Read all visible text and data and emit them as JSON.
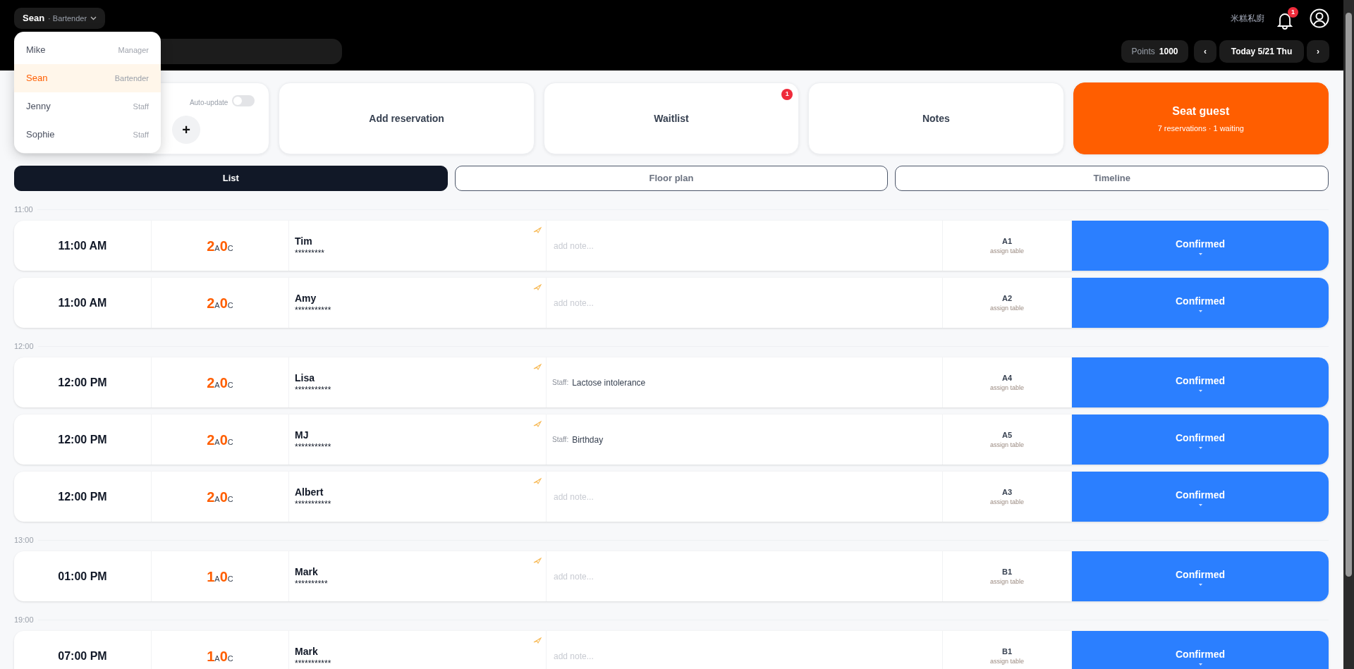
{
  "header": {
    "user": {
      "name": "Sean",
      "role": "· Bartender"
    },
    "restaurant": "米糕私廚",
    "notifications": "1",
    "points": {
      "label": "Points",
      "value": "1000"
    },
    "date": {
      "prev": "‹",
      "label": "Today 5/21 Thu",
      "next": "›"
    }
  },
  "staff_menu": [
    {
      "name": "Mike",
      "role": "Manager",
      "selected": false
    },
    {
      "name": "Sean",
      "role": "Bartender",
      "selected": true
    },
    {
      "name": "Jenny",
      "role": "Staff",
      "selected": false
    },
    {
      "name": "Sophie",
      "role": "Staff",
      "selected": false
    }
  ],
  "auto_update": {
    "label": "Auto-update",
    "on": false
  },
  "add_button": "+",
  "actions": [
    {
      "kind": "plain",
      "label": "Add reservation"
    },
    {
      "kind": "plain",
      "label": "Waitlist",
      "badge": "1"
    },
    {
      "kind": "plain",
      "label": "Notes"
    },
    {
      "kind": "primary",
      "label": "Seat guest",
      "sub": "7 reservations · 1 waiting"
    }
  ],
  "views": [
    {
      "label": "List",
      "selected": true
    },
    {
      "label": "Floor plan",
      "selected": false
    },
    {
      "label": "Timeline",
      "selected": false
    }
  ],
  "groups": [
    {
      "hour": "11:00",
      "rows": [
        {
          "time": "11:00 AM",
          "adults": "2",
          "adult_mark": "A",
          "children": "0",
          "child_mark": "C",
          "name": "Tim",
          "phone": "*********",
          "note_placeholder": "add note...",
          "table": "A1",
          "table_hint": "assign table",
          "status": "Confirmed"
        },
        {
          "time": "11:00 AM",
          "adults": "2",
          "adult_mark": "A",
          "children": "0",
          "child_mark": "C",
          "name": "Amy",
          "phone": "***********",
          "note_placeholder": "add note...",
          "table": "A2",
          "table_hint": "assign table",
          "status": "Confirmed"
        }
      ]
    },
    {
      "hour": "12:00",
      "rows": [
        {
          "time": "12:00 PM",
          "adults": "2",
          "adult_mark": "A",
          "children": "0",
          "child_mark": "C",
          "name": "Lisa",
          "phone": "***********",
          "note": {
            "label": "Staff:",
            "text": "Lactose intolerance"
          },
          "table": "A4",
          "table_hint": "assign table",
          "status": "Confirmed"
        },
        {
          "time": "12:00 PM",
          "adults": "2",
          "adult_mark": "A",
          "children": "0",
          "child_mark": "C",
          "name": "MJ",
          "phone": "***********",
          "note": {
            "label": "Staff:",
            "text": "Birthday"
          },
          "table": "A5",
          "table_hint": "assign table",
          "status": "Confirmed"
        },
        {
          "time": "12:00 PM",
          "adults": "2",
          "adult_mark": "A",
          "children": "0",
          "child_mark": "C",
          "name": "Albert",
          "phone": "***********",
          "note_placeholder": "add note...",
          "table": "A3",
          "table_hint": "assign table",
          "status": "Confirmed"
        }
      ]
    },
    {
      "hour": "13:00",
      "rows": [
        {
          "time": "01:00 PM",
          "adults": "1",
          "adult_mark": "A",
          "children": "0",
          "child_mark": "C",
          "name": "Mark",
          "phone": "**********",
          "note_placeholder": "add note...",
          "table": "B1",
          "table_hint": "assign table",
          "status": "Confirmed"
        }
      ]
    },
    {
      "hour": "19:00",
      "rows": [
        {
          "time": "07:00 PM",
          "adults": "1",
          "adult_mark": "A",
          "children": "0",
          "child_mark": "C",
          "name": "Mark",
          "phone": "***********",
          "note_placeholder": "add note...",
          "table": "B1",
          "table_hint": "assign table",
          "status": "Confirmed"
        }
      ]
    }
  ]
}
